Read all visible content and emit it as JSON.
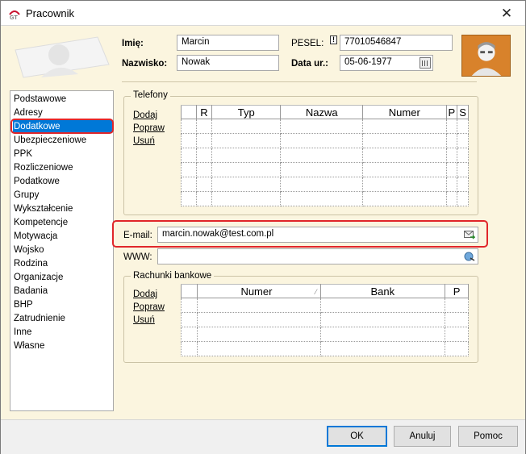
{
  "window": {
    "title": "Pracownik",
    "close": "✕"
  },
  "header": {
    "imie_label": "Imię:",
    "imie_value": "Marcin",
    "nazwisko_label": "Nazwisko:",
    "nazwisko_value": "Nowak",
    "pesel_label": "PESEL:",
    "pesel_value": "77010546847",
    "pesel_warning": "!",
    "data_label": "Data ur.:",
    "data_value": "05-06-1977"
  },
  "sidebar": {
    "items": [
      "Podstawowe",
      "Adresy",
      "Dodatkowe",
      "Ubezpieczeniowe",
      "PPK",
      "Rozliczeniowe",
      "Podatkowe",
      "Grupy",
      "Wykształcenie",
      "Kompetencje",
      "Motywacja",
      "Wojsko",
      "Rodzina",
      "Organizacje",
      "Badania",
      "BHP",
      "Zatrudnienie",
      "Inne",
      "Własne"
    ],
    "selected": "Dodatkowe"
  },
  "telefony": {
    "title": "Telefony",
    "actions": {
      "add": "Dodaj",
      "edit": "Popraw",
      "delete": "Usuń"
    },
    "columns": [
      "",
      "R",
      "Typ",
      "Nazwa",
      "Numer",
      "P",
      "S"
    ]
  },
  "contact": {
    "email_label": "E-mail:",
    "email_value": "marcin.nowak@test.com.pl",
    "www_label": "WWW:",
    "www_value": ""
  },
  "rachunki": {
    "title": "Rachunki bankowe",
    "actions": {
      "add": "Dodaj",
      "edit": "Popraw",
      "delete": "Usuń"
    },
    "columns": [
      "",
      "Numer",
      "Bank",
      "P"
    ]
  },
  "footer": {
    "ok": "OK",
    "cancel": "Anuluj",
    "help": "Pomoc"
  },
  "colors": {
    "background": "#fbf5df",
    "selection": "#0078d7",
    "highlight": "#e0262a"
  }
}
